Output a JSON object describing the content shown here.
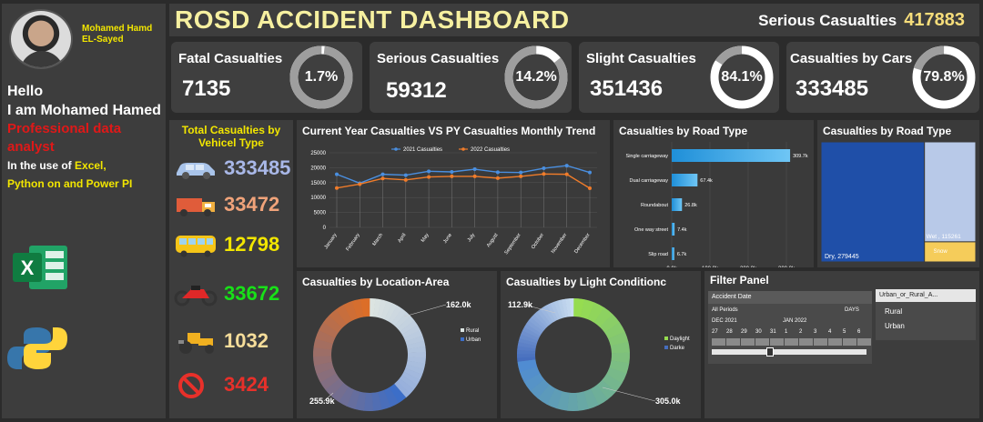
{
  "author": {
    "name": "Mohamed Hamd EL-Sayed",
    "intro_hello": "Hello",
    "intro_name": "I am Mohamed Hamed",
    "intro_role": "Professional data analyst",
    "intro_usage_prefix": "In the use of ",
    "intro_usage_tools1": "Excel,",
    "intro_usage_tools2": "Python on and Power PI"
  },
  "header": {
    "title": "ROSD ACCIDENT DASHBOARD",
    "serious_label": "Serious Casualties",
    "serious_value": "417883"
  },
  "kpis": [
    {
      "label": "Fatal Casualties",
      "value": "7135",
      "pct": "1.7%",
      "fraction": 0.017
    },
    {
      "label": "Serious Casualties",
      "value": "59312",
      "pct": "14.2%",
      "fraction": 0.142
    },
    {
      "label": "Slight Casualties",
      "value": "351436",
      "pct": "84.1%",
      "fraction": 0.841
    },
    {
      "label": "Casualties by Cars",
      "value": "333485",
      "pct": "79.8%",
      "fraction": 0.798
    }
  ],
  "vehicles": {
    "title": "Total Casualties by Vehicel Type",
    "rows": [
      {
        "icon": "car-icon",
        "value": "333485",
        "color": "#a9b8e8"
      },
      {
        "icon": "truck-icon",
        "value": "33472",
        "color": "#f0a37a"
      },
      {
        "icon": "bus-icon",
        "value": "12798",
        "color": "#f2e600"
      },
      {
        "icon": "motorcycle-icon",
        "value": "33672",
        "color": "#18e018"
      },
      {
        "icon": "tractor-icon",
        "value": "1032",
        "color": "#f6dd9a"
      },
      {
        "icon": "prohibited-icon",
        "value": "3424",
        "color": "#e8302a"
      }
    ]
  },
  "colors": {
    "cy": "#4a8fe0",
    "py": "#f07c2a",
    "ring": "#9e9e9e",
    "ring_track": "#ffffff"
  },
  "chart_data": [
    {
      "type": "line",
      "title": "Current Year Casualties VS PY Casualties Monthly Trend",
      "categories": [
        "January",
        "February",
        "March",
        "April",
        "May",
        "June",
        "July",
        "August",
        "September",
        "October",
        "November",
        "December"
      ],
      "series": [
        {
          "name": "2021 Casualties",
          "values": [
            17800,
            14800,
            17800,
            17500,
            18800,
            18600,
            19500,
            18500,
            18400,
            19800,
            20700,
            18400
          ]
        },
        {
          "name": "2022 Casualties",
          "values": [
            13200,
            14500,
            16400,
            15900,
            16900,
            17100,
            17100,
            16500,
            17100,
            17900,
            17800,
            13100
          ]
        }
      ],
      "yticks": [
        "25000",
        "20000",
        "15000",
        "10000",
        "5000",
        "0"
      ],
      "ylim": [
        0,
        25000
      ]
    },
    {
      "type": "bar",
      "title": "Casualties by Road Type",
      "categories": [
        "Single carriageway",
        "Dual carriageway",
        "Roundabout",
        "One way street",
        "Slip road"
      ],
      "values": [
        309700,
        67400,
        26800,
        7400,
        6700
      ],
      "labels": [
        "309.7k",
        "67.4k",
        "26.8k",
        "7.4k",
        "6.7k"
      ],
      "xticks": [
        "0.0k",
        "100.0k",
        "200.0k",
        "300.0k"
      ],
      "xlim": [
        0,
        300000
      ]
    },
    {
      "type": "treemap",
      "title": "Casualties by Road Type",
      "items": [
        {
          "name": "Dry",
          "value": 279445,
          "label": "Dry, 279445"
        },
        {
          "name": "Wet",
          "value": 115261,
          "label": "Wet , 115261"
        },
        {
          "name": "Snow",
          "value": 23177,
          "label": "Snow"
        }
      ]
    },
    {
      "type": "pie",
      "title": "Casualties by Location-Area",
      "slices": [
        {
          "name": "Rural",
          "value": 162000,
          "label": "162.0k"
        },
        {
          "name": "Urban",
          "value": 255900,
          "label": "255.9k"
        }
      ]
    },
    {
      "type": "pie",
      "title": "Casualties by Light Conditionc",
      "slices": [
        {
          "name": "Daylight",
          "value": 305000,
          "label": "305.0k"
        },
        {
          "name": "Darke",
          "value": 112900,
          "label": "112.9k"
        }
      ]
    }
  ],
  "filter": {
    "title": "Filter Panel",
    "date_label": "Accident Date",
    "all_periods": "All Periods",
    "days": "DAYS",
    "month1": "DEC 2021",
    "month2": "JAN 2022",
    "days_list": [
      "27",
      "28",
      "29",
      "30",
      "31",
      "1",
      "2",
      "3",
      "4",
      "5",
      "6"
    ],
    "urban_label": "Urban_or_Rural_A...",
    "urban_options": [
      "Rural",
      "Urban"
    ]
  }
}
